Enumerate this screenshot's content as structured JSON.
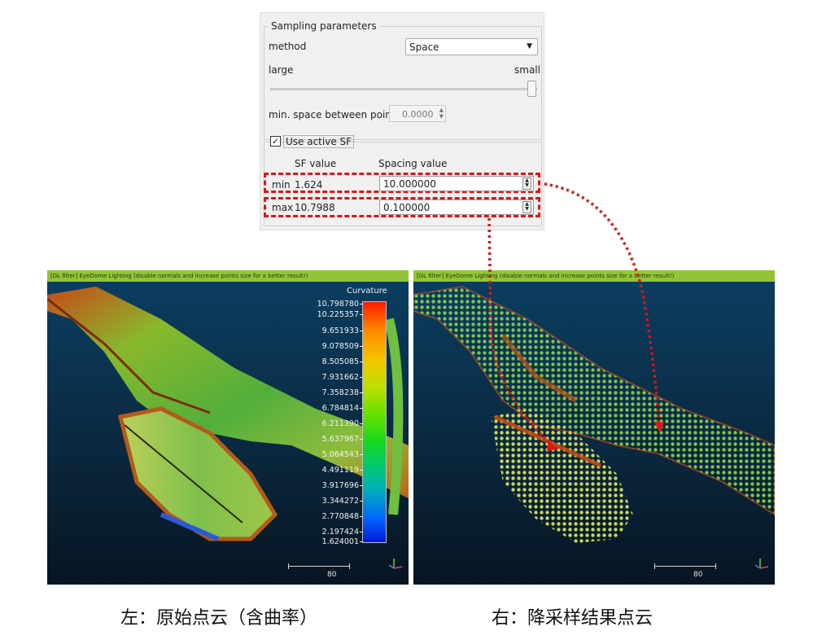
{
  "sampling_panel": {
    "group_title": "Sampling parameters",
    "method_label": "method",
    "method_value": "Space",
    "slider_left_label": "large",
    "slider_right_label": "small",
    "min_space_label": "min. space between points",
    "min_space_value": "0.0000",
    "use_active_sf_label": "Use active SF",
    "use_active_sf_checked": true,
    "sf_value_header": "SF value",
    "spacing_value_header": "Spacing value",
    "rows": [
      {
        "name": "min",
        "sf": "1.624",
        "spacing": "10.000000"
      },
      {
        "name": "max",
        "sf": "10.7988",
        "spacing": "0.100000"
      }
    ]
  },
  "left_view": {
    "filter_text": "[GL filter] EyeDome Lighting (disable normals and increase points size for a better result!)",
    "scale_label": "80",
    "colorbar": {
      "title": "Curvature",
      "ticks": [
        "10.798780",
        "10.225357",
        "9.651933",
        "9.078509",
        "8.505085",
        "7.931662",
        "7.358238",
        "6.784814",
        "6.211390",
        "5.637967",
        "5.064543",
        "4.491119",
        "3.917696",
        "3.344272",
        "2.770848",
        "2.197424",
        "1.624001"
      ]
    }
  },
  "right_view": {
    "filter_text": "[GL filter] EyeDome Lighting (disable normals and increase points size for a better result!)",
    "scale_label": "80"
  },
  "captions": {
    "left": "左：原始点云（含曲率）",
    "right": "右：降采样结果点云"
  },
  "colors": {
    "highlight_red": "#e01414",
    "topbar_green": "#92c43a"
  }
}
